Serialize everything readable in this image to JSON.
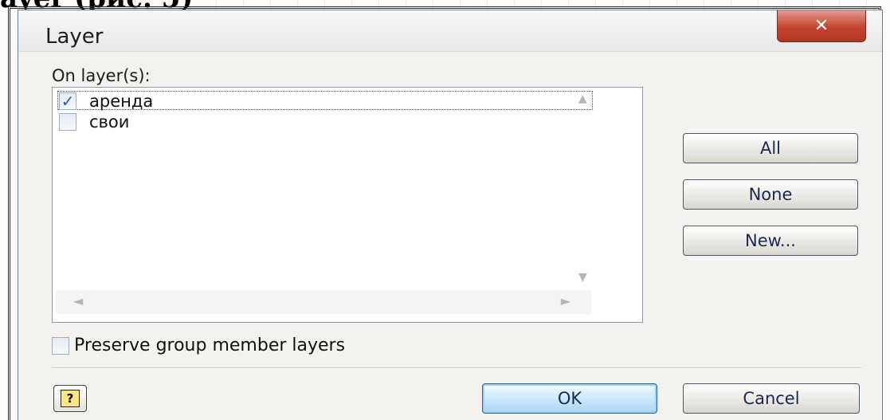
{
  "background": {
    "heading_fragment": "ayer (рис. 5)"
  },
  "dialog": {
    "title": "Layer",
    "close_glyph": "✕",
    "on_layers_label": "On layer(s):",
    "layers": [
      {
        "name": "аренда",
        "checked": true
      },
      {
        "name": "свои",
        "checked": false
      }
    ],
    "buttons": {
      "all": "All",
      "none": "None",
      "new": "New...",
      "ok": "OK",
      "cancel": "Cancel"
    },
    "preserve_label": "Preserve group member layers",
    "preserve_checked": false,
    "help_glyph": "?"
  },
  "colors": {
    "dialog_bg": "#f3f2ee",
    "close_red": "#c4432f",
    "ok_blue": "#a9d6f3"
  },
  "icons": {
    "close": "close-icon",
    "help": "help-icon",
    "check": "checkmark-icon",
    "scroll_up": "scroll-up-arrow-icon",
    "scroll_down": "scroll-down-arrow-icon",
    "scroll_left": "scroll-left-arrow-icon",
    "scroll_right": "scroll-right-arrow-icon"
  }
}
